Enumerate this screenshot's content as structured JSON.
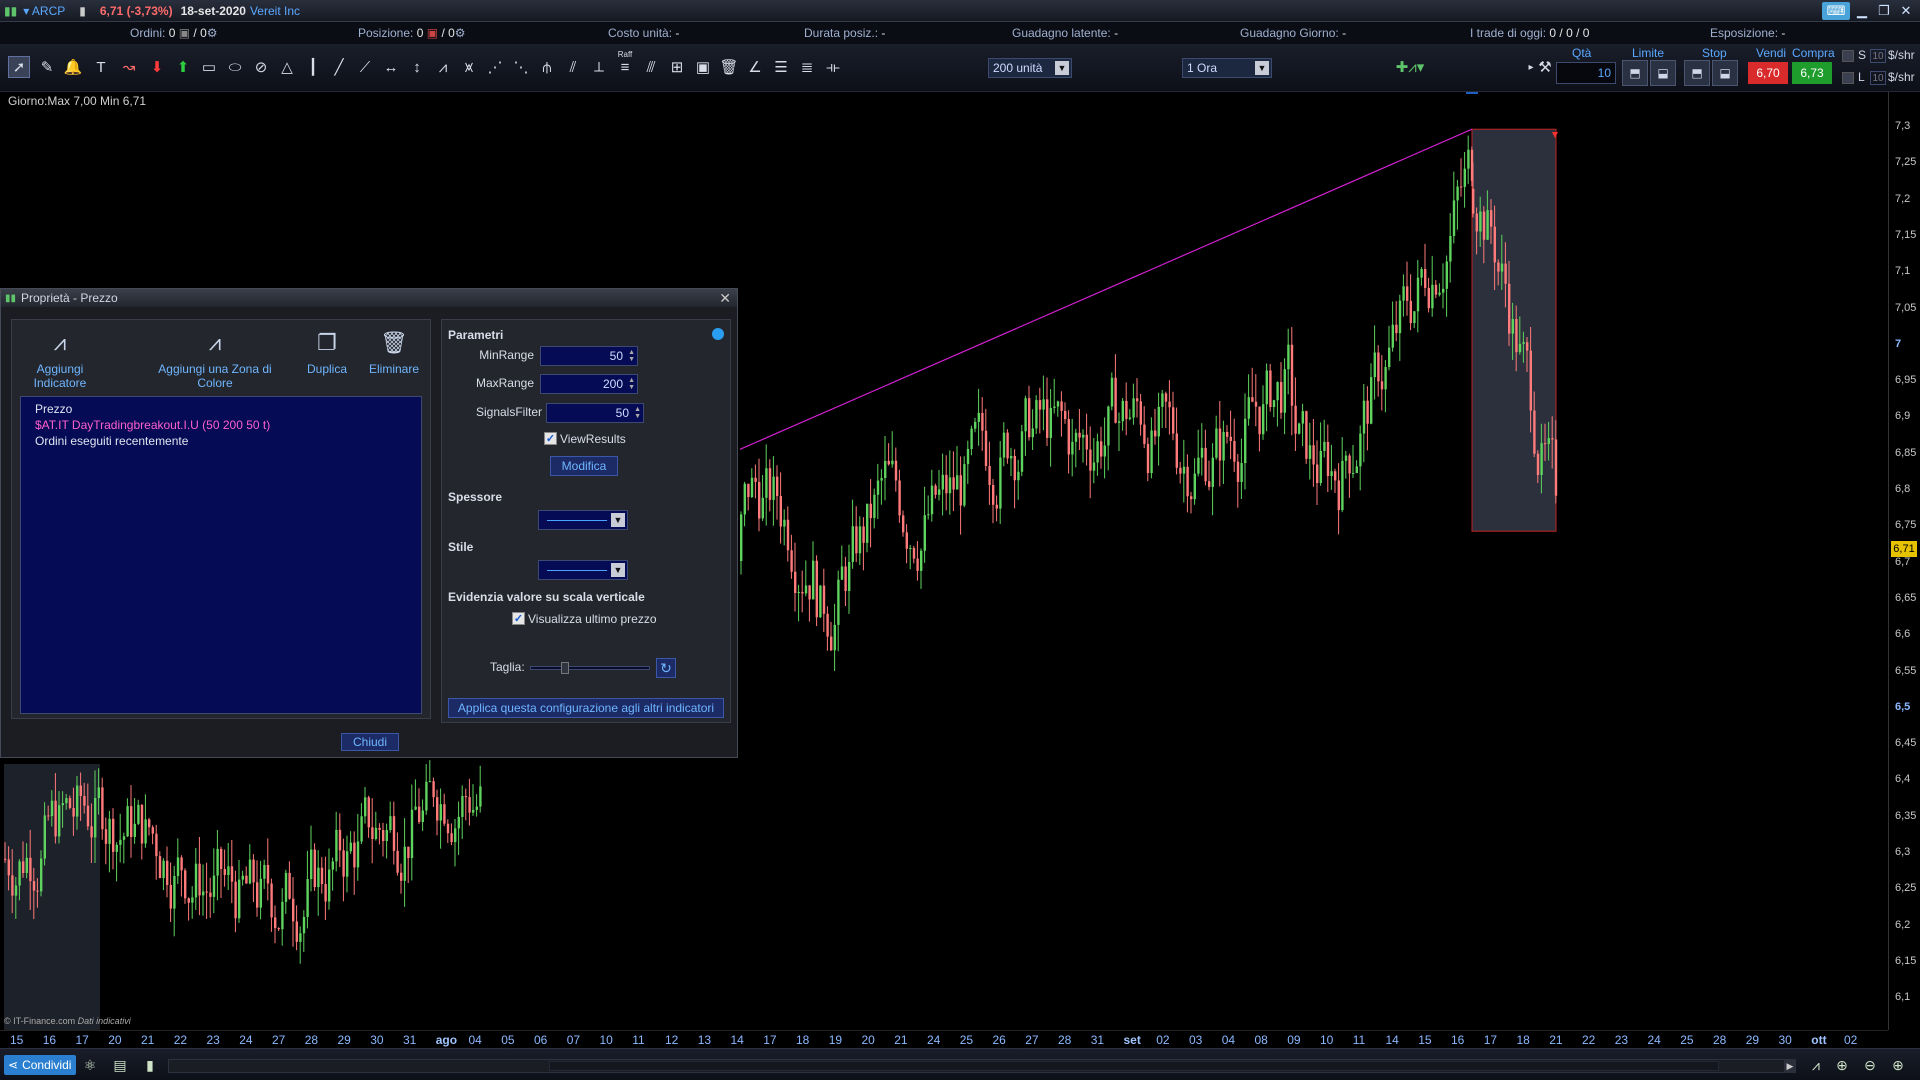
{
  "titlebar": {
    "symbol": "ARCP",
    "price_change": "6,71 (-3,73%)",
    "date": "18-set-2020",
    "company": "Vereit Inc"
  },
  "infobar": {
    "ordini_label": "Ordini:",
    "ordini_value": "0",
    "ordini_value2": "/ 0",
    "posizione_label": "Posizione:",
    "posizione_value": "0",
    "posizione_value2": "/ 0",
    "costo_label": "Costo unità:",
    "costo_value": "-",
    "durata_label": "Durata posiz.:",
    "durata_value": "-",
    "latente_label": "Guadagno latente:",
    "latente_value": "-",
    "giorno_label": "Guadagno Giorno:",
    "giorno_value": "-",
    "trade_label": "I trade di oggi:",
    "trade_value": "0 / 0 / 0",
    "esposizione_label": "Esposizione:",
    "esposizione_value": "-"
  },
  "toolbar": {
    "units_dropdown": "200 unità",
    "timeframe_dropdown": "1 Ora",
    "qta_label": "Qtà",
    "qta_value": "10",
    "limite_label": "Limite",
    "stop_label": "Stop",
    "vendi_label": "Vendi",
    "vendi_price": "6,70",
    "compra_label": "Compra",
    "compra_price": "6,73",
    "s_label": "S",
    "l_label": "L",
    "s_qty": "10",
    "l_qty": "10",
    "shr_unit_s": "$/shr",
    "shr_unit_l": "$/shr",
    "raff_label": "Raff"
  },
  "chart": {
    "info": "Giorno:Max 7,00 Min 6,71",
    "credit": "© IT-Finance.com",
    "credit_note": "Dati indicativi",
    "last_price": "6,71",
    "y_ticks": [
      "7,3",
      "7,25",
      "7,2",
      "7,15",
      "7,1",
      "7,05",
      "7",
      "6,95",
      "6,9",
      "6,85",
      "6,8",
      "6,75",
      "6,7",
      "6,65",
      "6,6",
      "6,55",
      "6,5",
      "6,45",
      "6,4",
      "6,35",
      "6,3",
      "6,25",
      "6,2",
      "6,15",
      "6,1"
    ],
    "x_ticks": [
      "15",
      "16",
      "17",
      "20",
      "21",
      "22",
      "23",
      "24",
      "27",
      "28",
      "29",
      "30",
      "31",
      "ago",
      "04",
      "05",
      "06",
      "07",
      "10",
      "11",
      "12",
      "13",
      "14",
      "17",
      "18",
      "19",
      "20",
      "21",
      "24",
      "25",
      "26",
      "27",
      "28",
      "31",
      "set",
      "02",
      "03",
      "04",
      "08",
      "09",
      "10",
      "11",
      "14",
      "15",
      "16",
      "17",
      "18",
      "21",
      "22",
      "23",
      "24",
      "25",
      "28",
      "29",
      "30",
      "ott",
      "02"
    ]
  },
  "chart_data": {
    "type": "candlestick",
    "symbol": "ARCP",
    "ylim": [
      6.07,
      7.33
    ],
    "last": 6.71,
    "day_high": 7.0,
    "day_low": 6.71,
    "trendline": {
      "from_price": 6.85,
      "to_price": 7.28
    },
    "highlight_box": {
      "top_price": 7.28,
      "bottom_price": 6.74
    }
  },
  "dialog": {
    "title": "Proprietà - Prezzo",
    "tools": {
      "add_indicator": "Aggiungi Indicatore",
      "add_zone": "Aggiungi una Zona di Colore",
      "duplicate": "Duplica",
      "delete": "Eliminare"
    },
    "list": [
      "Prezzo",
      "$AT.IT DayTradingbreakout.I.U (50 200 50 t)",
      "Ordini eseguiti recentemente"
    ],
    "params_title": "Parametri",
    "params": {
      "minrange_label": "MinRange",
      "minrange_value": "50",
      "maxrange_label": "MaxRange",
      "maxrange_value": "200",
      "signals_label": "SignalsFilter",
      "signals_value": "50",
      "viewresults_label": "ViewResults"
    },
    "modify_btn": "Modifica",
    "spessore_label": "Spessore",
    "stile_label": "Stile",
    "evidenzia_label": "Evidenzia valore su scala verticale",
    "visualizza_label": "Visualizza ultimo prezzo",
    "taglia_label": "Taglia:",
    "apply_btn": "Applica questa configurazione agli altri indicatori",
    "close_btn": "Chiudi"
  },
  "bottombar": {
    "share": "Condividi"
  }
}
